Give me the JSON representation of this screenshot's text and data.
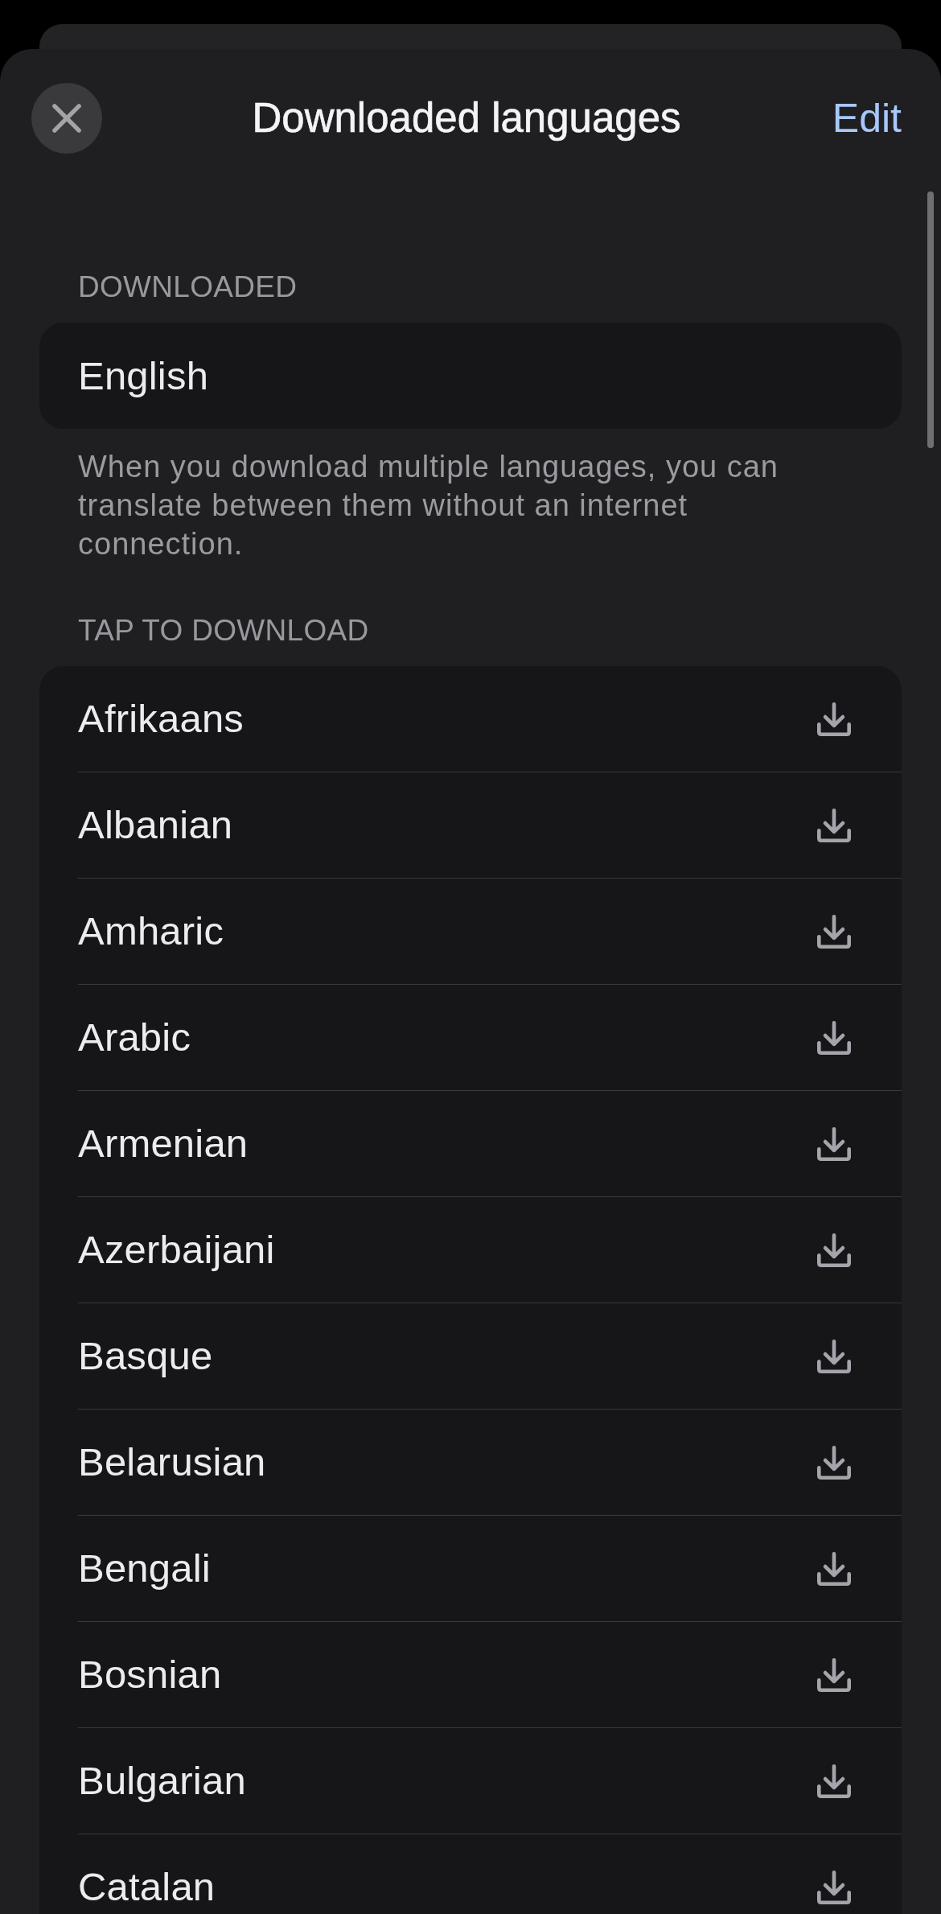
{
  "header": {
    "title": "Downloaded languages",
    "edit": "Edit"
  },
  "downloaded": {
    "heading": "DOWNLOADED",
    "languages": [
      "English"
    ],
    "note": "When you download multiple languages, you can translate between them without an internet connection."
  },
  "available": {
    "heading": "TAP TO DOWNLOAD",
    "languages": [
      "Afrikaans",
      "Albanian",
      "Amharic",
      "Arabic",
      "Armenian",
      "Azerbaijani",
      "Basque",
      "Belarusian",
      "Bengali",
      "Bosnian",
      "Bulgarian",
      "Catalan"
    ]
  }
}
